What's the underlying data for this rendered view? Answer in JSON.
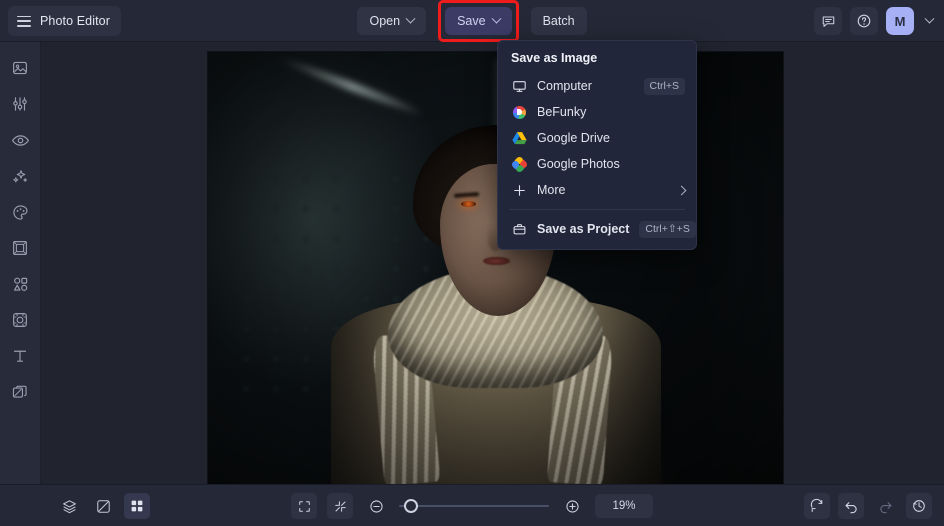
{
  "app": {
    "name": "Photo Editor",
    "menu_icon": "hamburger-icon"
  },
  "toolbar": {
    "open_label": "Open",
    "save_label": "Save",
    "batch_label": "Batch",
    "highlight_color": "#ef1c1c",
    "save_bg": "#3b3b66"
  },
  "account": {
    "initial": "M",
    "avatar_color": "#a5b0f5",
    "feedback_icon": "comment-icon",
    "help_icon": "help-circle-icon",
    "chevron_icon": "chevron-down-icon"
  },
  "sidebar": {
    "items": [
      {
        "name": "image",
        "icon": "image-icon"
      },
      {
        "name": "edit",
        "icon": "sliders-icon"
      },
      {
        "name": "touch-up",
        "icon": "eye-icon"
      },
      {
        "name": "effects",
        "icon": "sparkles-icon"
      },
      {
        "name": "artsy",
        "icon": "palette-icon"
      },
      {
        "name": "frames",
        "icon": "frame-icon"
      },
      {
        "name": "graphics",
        "icon": "shapes-icon"
      },
      {
        "name": "overlays",
        "icon": "overlay-icon"
      },
      {
        "name": "text",
        "icon": "text-icon"
      },
      {
        "name": "layers",
        "icon": "layers-duplicate-icon"
      }
    ]
  },
  "save_menu": {
    "title": "Save as Image",
    "items": [
      {
        "label": "Computer",
        "icon": "monitor-icon",
        "shortcut": "Ctrl+S",
        "arrow": false
      },
      {
        "label": "BeFunky",
        "icon": "befunky-logo-icon",
        "shortcut": "",
        "arrow": false
      },
      {
        "label": "Google Drive",
        "icon": "google-drive-icon",
        "shortcut": "",
        "arrow": false
      },
      {
        "label": "Google Photos",
        "icon": "google-photos-icon",
        "shortcut": "",
        "arrow": false
      },
      {
        "label": "More",
        "icon": "plus-icon",
        "shortcut": "",
        "arrow": true
      }
    ],
    "project": {
      "label": "Save as Project",
      "icon": "briefcase-icon",
      "shortcut": "Ctrl+⇧+S"
    }
  },
  "bottombar": {
    "left_tools": [
      {
        "name": "layers",
        "icon": "layers-icon",
        "active": false
      },
      {
        "name": "compare",
        "icon": "compare-icon",
        "active": false
      },
      {
        "name": "grid",
        "icon": "grid-icon",
        "active": true
      }
    ],
    "view_tools": [
      {
        "name": "fullscreen",
        "icon": "expand-icon"
      },
      {
        "name": "fit-screen",
        "icon": "collapse-icon"
      }
    ],
    "zoom": {
      "minus_icon": "minus-circle-icon",
      "plus_icon": "plus-circle-icon",
      "value": "19%",
      "slider_position_pct": 6
    },
    "history_tools": [
      {
        "name": "reset",
        "icon": "reset-icon",
        "disabled": false
      },
      {
        "name": "undo",
        "icon": "undo-icon",
        "disabled": false
      },
      {
        "name": "redo",
        "icon": "redo-icon",
        "disabled": true
      },
      {
        "name": "history",
        "icon": "history-icon",
        "disabled": false
      }
    ]
  },
  "canvas": {
    "image_alt": "dark cinematic portrait of a young man with glowing orange eyes wearing a scarf"
  }
}
